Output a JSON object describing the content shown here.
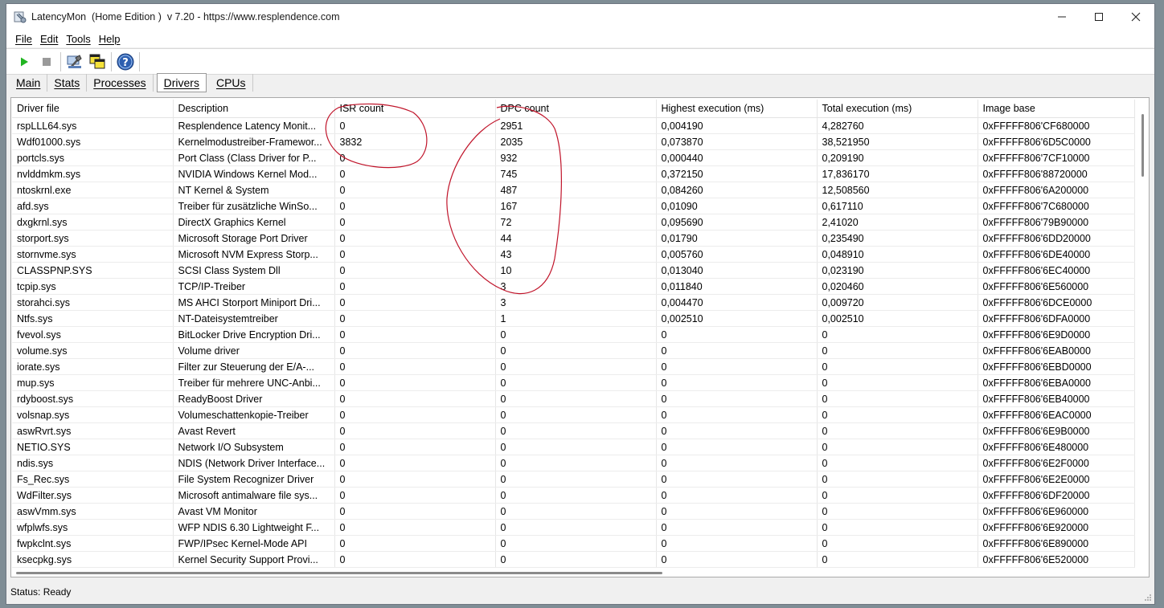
{
  "window": {
    "title": "LatencyMon  (Home Edition )  v 7.20 - https://www.resplendence.com"
  },
  "menu": [
    {
      "label": "File"
    },
    {
      "label": "Edit"
    },
    {
      "label": "Tools"
    },
    {
      "label": "Help"
    }
  ],
  "tabs": [
    {
      "label": "Main"
    },
    {
      "label": "Stats"
    },
    {
      "label": "Processes"
    },
    {
      "label": "Drivers",
      "active": true
    },
    {
      "label": "CPUs"
    }
  ],
  "table": {
    "columns": [
      "Driver file",
      "Description",
      "ISR count",
      "DPC count",
      "Highest execution (ms)",
      "Total execution (ms)",
      "Image base"
    ],
    "rows": [
      [
        "rspLLL64.sys",
        "Resplendence Latency Monit...",
        "0",
        "2951",
        "0,004190",
        "4,282760",
        "0xFFFFF806'CF680000"
      ],
      [
        "Wdf01000.sys",
        "Kernelmodustreiber-Framewor...",
        "3832",
        "2035",
        "0,073870",
        "38,521950",
        "0xFFFFF806'6D5C0000"
      ],
      [
        "portcls.sys",
        "Port Class (Class Driver for P...",
        "0",
        "932",
        "0,000440",
        "0,209190",
        "0xFFFFF806'7CF10000"
      ],
      [
        "nvlddmkm.sys",
        "NVIDIA Windows Kernel Mod...",
        "0",
        "745",
        "0,372150",
        "17,836170",
        "0xFFFFF806'88720000"
      ],
      [
        "ntoskrnl.exe",
        "NT Kernel & System",
        "0",
        "487",
        "0,084260",
        "12,508560",
        "0xFFFFF806'6A200000"
      ],
      [
        "afd.sys",
        "Treiber für zusätzliche WinSo...",
        "0",
        "167",
        "0,01090",
        "0,617110",
        "0xFFFFF806'7C680000"
      ],
      [
        "dxgkrnl.sys",
        "DirectX Graphics Kernel",
        "0",
        "72",
        "0,095690",
        "2,41020",
        "0xFFFFF806'79B90000"
      ],
      [
        "storport.sys",
        "Microsoft Storage Port Driver",
        "0",
        "44",
        "0,01790",
        "0,235490",
        "0xFFFFF806'6DD20000"
      ],
      [
        "stornvme.sys",
        "Microsoft NVM Express Storp...",
        "0",
        "43",
        "0,005760",
        "0,048910",
        "0xFFFFF806'6DE40000"
      ],
      [
        "CLASSPNP.SYS",
        "SCSI Class System Dll",
        "0",
        "10",
        "0,013040",
        "0,023190",
        "0xFFFFF806'6EC40000"
      ],
      [
        "tcpip.sys",
        "TCP/IP-Treiber",
        "0",
        "3",
        "0,011840",
        "0,020460",
        "0xFFFFF806'6E560000"
      ],
      [
        "storahci.sys",
        "MS AHCI Storport Miniport Dri...",
        "0",
        "3",
        "0,004470",
        "0,009720",
        "0xFFFFF806'6DCE0000"
      ],
      [
        "Ntfs.sys",
        "NT-Dateisystemtreiber",
        "0",
        "1",
        "0,002510",
        "0,002510",
        "0xFFFFF806'6DFA0000"
      ],
      [
        "fvevol.sys",
        "BitLocker Drive Encryption Dri...",
        "0",
        "0",
        "0",
        "0",
        "0xFFFFF806'6E9D0000"
      ],
      [
        "volume.sys",
        "Volume driver",
        "0",
        "0",
        "0",
        "0",
        "0xFFFFF806'6EAB0000"
      ],
      [
        "iorate.sys",
        "Filter zur Steuerung der E/A-...",
        "0",
        "0",
        "0",
        "0",
        "0xFFFFF806'6EBD0000"
      ],
      [
        "mup.sys",
        "Treiber für mehrere UNC-Anbi...",
        "0",
        "0",
        "0",
        "0",
        "0xFFFFF806'6EBA0000"
      ],
      [
        "rdyboost.sys",
        "ReadyBoost Driver",
        "0",
        "0",
        "0",
        "0",
        "0xFFFFF806'6EB40000"
      ],
      [
        "volsnap.sys",
        "Volumeschattenkopie-Treiber",
        "0",
        "0",
        "0",
        "0",
        "0xFFFFF806'6EAC0000"
      ],
      [
        "aswRvrt.sys",
        "Avast Revert",
        "0",
        "0",
        "0",
        "0",
        "0xFFFFF806'6E9B0000"
      ],
      [
        "NETIO.SYS",
        "Network I/O Subsystem",
        "0",
        "0",
        "0",
        "0",
        "0xFFFFF806'6E480000"
      ],
      [
        "ndis.sys",
        "NDIS (Network Driver Interface...",
        "0",
        "0",
        "0",
        "0",
        "0xFFFFF806'6E2F0000"
      ],
      [
        "Fs_Rec.sys",
        "File System Recognizer Driver",
        "0",
        "0",
        "0",
        "0",
        "0xFFFFF806'6E2E0000"
      ],
      [
        "WdFilter.sys",
        "Microsoft antimalware file sys...",
        "0",
        "0",
        "0",
        "0",
        "0xFFFFF806'6DF20000"
      ],
      [
        "aswVmm.sys",
        "Avast VM Monitor",
        "0",
        "0",
        "0",
        "0",
        "0xFFFFF806'6E960000"
      ],
      [
        "wfplwfs.sys",
        "WFP NDIS 6.30 Lightweight F...",
        "0",
        "0",
        "0",
        "0",
        "0xFFFFF806'6E920000"
      ],
      [
        "fwpkclnt.sys",
        "FWP/IPsec Kernel-Mode API",
        "0",
        "0",
        "0",
        "0",
        "0xFFFFF806'6E890000"
      ],
      [
        "ksecpkg.sys",
        "Kernel Security Support Provi...",
        "0",
        "0",
        "0",
        "0",
        "0xFFFFF806'6E520000"
      ]
    ]
  },
  "status": {
    "text": "Status: Ready"
  },
  "colors": {
    "annotation": "#c0142a",
    "play": "#21b521"
  }
}
